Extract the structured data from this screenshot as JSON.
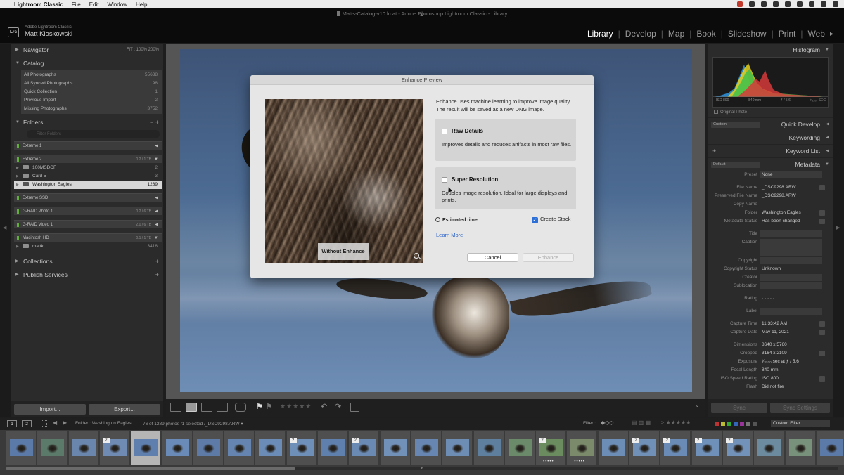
{
  "menubar": {
    "app": "Lightroom Classic",
    "items": [
      "File",
      "Edit",
      "Window",
      "Help"
    ]
  },
  "titlebar": {
    "title": "Matts-Catalog-v10.lrcat - Adobe Photoshop Lightroom Classic - Library"
  },
  "identity": {
    "badge": "Lrc",
    "app_line": "Adobe Lightroom Classic",
    "user": "Matt Kloskowski"
  },
  "modules": [
    "Library",
    "Develop",
    "Map",
    "Book",
    "Slideshow",
    "Print",
    "Web"
  ],
  "left_panel": {
    "navigator": {
      "title": "Navigator",
      "zooms": "FIT  :  100%  200%"
    },
    "catalog": {
      "title": "Catalog",
      "items": [
        {
          "label": "All Photographs",
          "count": "55638"
        },
        {
          "label": "All Synced Photographs",
          "count": "98"
        },
        {
          "label": "Quick Collection",
          "count": "1"
        },
        {
          "label": "Previous Import",
          "count": "2"
        },
        {
          "label": "Missing Photographs",
          "count": "3752"
        }
      ]
    },
    "folders": {
      "title": "Folders",
      "controls": "−  +",
      "filter_placeholder": "Filter Folders",
      "volumes": [
        {
          "name": "Extreme 1",
          "capacity": ""
        },
        {
          "name": "Extreme 2",
          "capacity": "0.2 / 1 TB"
        },
        {
          "name": "Extreme SSD",
          "capacity": ""
        },
        {
          "name": "G-RAID Photo 1",
          "capacity": "0.2 / 6 TB"
        },
        {
          "name": "G-RAID Video 1",
          "capacity": "2.0 / 6 TB"
        },
        {
          "name": "Macintosh HD",
          "capacity": "0.1 / 1 TB"
        }
      ],
      "subfolders": [
        {
          "label": "100MSDCF",
          "count": "2"
        },
        {
          "label": "Card 5",
          "count": "3"
        },
        {
          "label": "Washington Eagles",
          "count": "1289"
        },
        {
          "label": "mattk",
          "count": "3418"
        }
      ]
    },
    "collections": {
      "title": "Collections"
    },
    "publish": {
      "title": "Publish Services"
    },
    "import_label": "Import...",
    "export_label": "Export..."
  },
  "right_panel": {
    "histogram": {
      "title": "Histogram",
      "iso": "ISO 800",
      "focal": "840 mm",
      "aperture": "ƒ / 5.6",
      "shutter": "¹⁄₃₂₀₀ SEC"
    },
    "original_photo": "Original Photo",
    "quick_develop": {
      "preset": "Custom",
      "title": "Quick Develop"
    },
    "keywording": "Keywording",
    "keyword_list": "Keyword List",
    "metadata": {
      "preset": "Default",
      "title": "Metadata"
    },
    "meta_fields": [
      {
        "k": "Preset",
        "v": "None"
      },
      {
        "k": "File Name",
        "v": "_DSC9298.ARW"
      },
      {
        "k": "Preserved File Name",
        "v": "_DSC9298.ARW"
      },
      {
        "k": "Copy Name",
        "v": ""
      },
      {
        "k": "Folder",
        "v": "Washington Eagles"
      },
      {
        "k": "Metadata Status",
        "v": "Has been changed"
      },
      {
        "k": "Title",
        "v": ""
      },
      {
        "k": "Caption",
        "v": ""
      },
      {
        "k": "Copyright",
        "v": ""
      },
      {
        "k": "Copyright Status",
        "v": "Unknown"
      },
      {
        "k": "Creator",
        "v": ""
      },
      {
        "k": "Sublocation",
        "v": ""
      },
      {
        "k": "Rating",
        "v": "·  ·  ·  ·  ·"
      },
      {
        "k": "Label",
        "v": ""
      },
      {
        "k": "Capture Time",
        "v": "11:33:42 AM"
      },
      {
        "k": "Capture Date",
        "v": "May 11, 2021"
      },
      {
        "k": "Dimensions",
        "v": "8640 x 5760"
      },
      {
        "k": "Cropped",
        "v": "3164 x 2109"
      },
      {
        "k": "Exposure",
        "v": "¹⁄₃₂₀₀ sec at ƒ / 5.6"
      },
      {
        "k": "Focal Length",
        "v": "840 mm"
      },
      {
        "k": "ISO Speed Rating",
        "v": "ISO 800"
      },
      {
        "k": "Flash",
        "v": "Did not fire"
      }
    ],
    "sync_label": "Sync",
    "sync_settings_label": "Sync Settings"
  },
  "dialog": {
    "title": "Enhance Preview",
    "preview_label": "Without Enhance",
    "intro": "Enhance uses machine learning to improve image quality. The result will be saved as a new DNG image.",
    "raw_details": {
      "title": "Raw Details",
      "desc": "Improves details and reduces artifacts in most raw files.",
      "checked": false
    },
    "super_resolution": {
      "title": "Super Resolution",
      "desc": "Doubles image resolution. Ideal for large displays and prints.",
      "checked": false
    },
    "estimated_time": "Estimated time:",
    "create_stack": "Create Stack",
    "create_stack_checked": true,
    "learn_more": "Learn More",
    "cancel": "Cancel",
    "enhance": "Enhance"
  },
  "filmstrip_bar": {
    "page1": "1",
    "page2": "2",
    "source": "Folder : Washington Eagles",
    "status": "76 of 1289 photos /1 selected /_DSC9298.ARW ▾",
    "filter_label": "Filter :",
    "custom_filter": "Custom Filter"
  },
  "filmstrip": {
    "selected_index": 4,
    "badges": {
      "3": "2",
      "9": "2",
      "11": "2",
      "17": "2",
      "20": "2",
      "21": "2",
      "22": "2",
      "23": "2"
    }
  },
  "colors": {
    "accent_blue": "#2c6fd6",
    "link_blue": "#2a62c9",
    "volume_led": "#5fae3e"
  }
}
